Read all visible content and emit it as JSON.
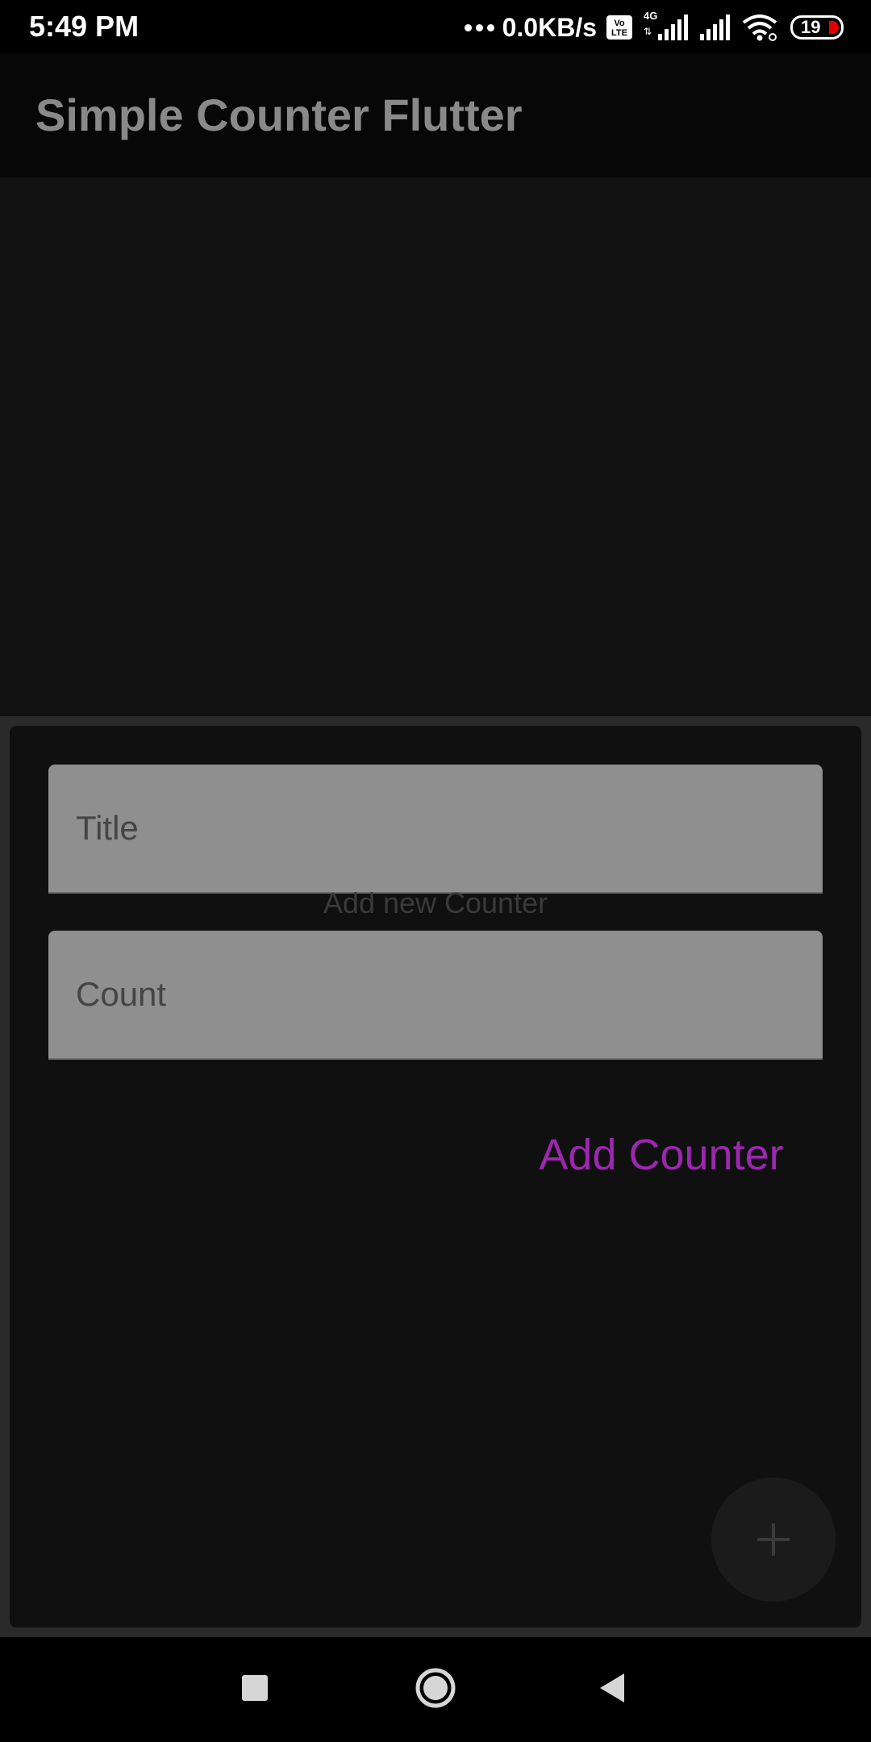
{
  "status_bar": {
    "time": "5:49 PM",
    "net_speed": "0.0KB/s",
    "volte_line1": "Vo",
    "volte_line2": "LTE",
    "network_type": "4G",
    "network_arrows": "⇅",
    "battery": "19"
  },
  "app_bar": {
    "title": "Simple Counter Flutter"
  },
  "sheet": {
    "heading": "Add new Counter",
    "title_field": {
      "placeholder": "Title",
      "value": ""
    },
    "count_field": {
      "placeholder": "Count",
      "value": ""
    },
    "submit_label": "Add Counter"
  },
  "fab": {
    "icon": "plus-icon"
  },
  "nav_bar": {
    "recents_icon": "square-icon",
    "home_icon": "circle-icon",
    "back_icon": "triangle-back-icon"
  },
  "colors": {
    "accent": "#9c27b0",
    "field_fill": "#8f8f8f",
    "background": "#101010",
    "app_bar": "#070707"
  }
}
